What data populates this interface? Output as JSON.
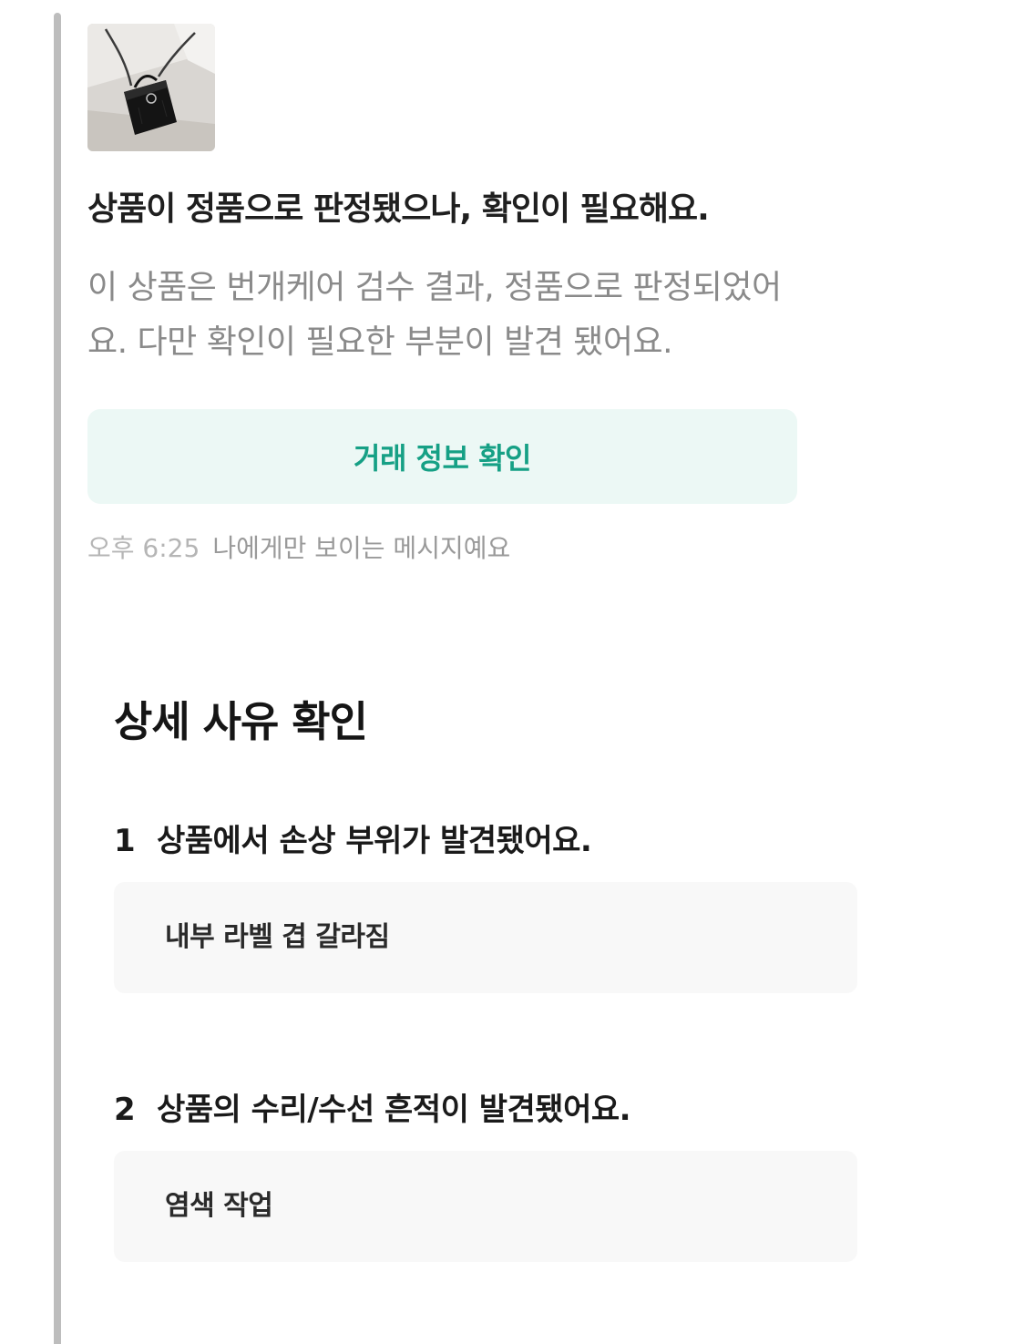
{
  "message": {
    "title": "상품이 정품으로 판정됐으나, 확인이 필요해요.",
    "body": "이 상품은 번개케어 검수 결과, 정품으로 판정되었어요. 다만 확인이 필요한 부분이 발견 됐어요.",
    "button_label": "거래 정보 확인",
    "time": "오후 6:25",
    "visibility_note": "나에게만 보이는 메시지예요"
  },
  "details": {
    "title": "상세 사유 확인",
    "reasons": [
      {
        "number": "1",
        "heading": "상품에서 손상 부위가 발견됐어요.",
        "detail": "내부 라벨 겹 갈라짐"
      },
      {
        "number": "2",
        "heading": "상품의 수리/수선 흔적이 발견됐어요.",
        "detail": "염색 작업"
      }
    ]
  },
  "colors": {
    "button_bg": "#ecf8f5",
    "button_text": "#16a085",
    "body_text": "#8a8a8a",
    "box_bg": "#f8f8f8"
  }
}
